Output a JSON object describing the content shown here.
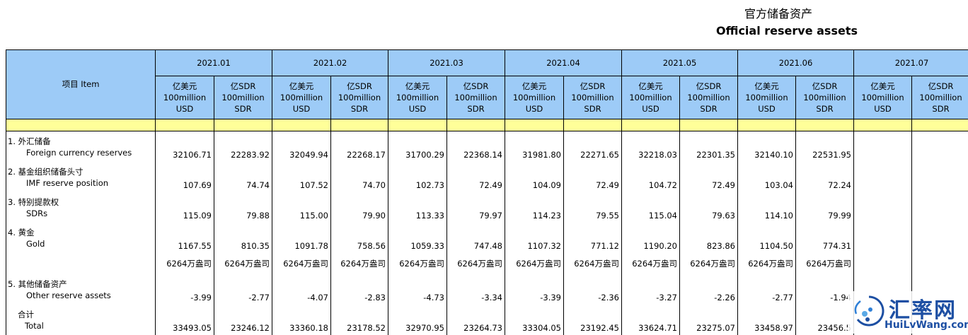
{
  "title_cn": "官方储备资产",
  "title_en": "Official reserve assets",
  "item_header": "项目  Item",
  "months": [
    "2021.01",
    "2021.02",
    "2021.03",
    "2021.04",
    "2021.05",
    "2021.06",
    "2021.07"
  ],
  "units": {
    "usd": [
      "亿美元",
      "100million",
      "USD"
    ],
    "sdr": [
      "亿SDR",
      "100million",
      "SDR"
    ]
  },
  "rows": [
    {
      "cn": "1.  外汇储备",
      "en": "Foreign currency reserves",
      "values": [
        "32106.71",
        "22283.92",
        "32049.94",
        "22268.17",
        "31700.29",
        "22368.14",
        "31981.80",
        "22271.65",
        "32218.03",
        "22301.35",
        "32140.10",
        "22531.95",
        "",
        ""
      ]
    },
    {
      "cn": "2.  基金组织储备头寸",
      "en": "IMF reserve position",
      "values": [
        "107.69",
        "74.74",
        "107.52",
        "74.70",
        "102.73",
        "72.49",
        "104.09",
        "72.49",
        "104.72",
        "72.49",
        "103.04",
        "72.24",
        "",
        ""
      ]
    },
    {
      "cn": "3.  特别提款权",
      "en": "SDRs",
      "values": [
        "115.09",
        "79.88",
        "115.00",
        "79.90",
        "113.33",
        "79.97",
        "114.23",
        "79.55",
        "115.04",
        "79.63",
        "114.10",
        "79.99",
        "",
        ""
      ]
    },
    {
      "cn": "4.  黄金",
      "en": "Gold",
      "values": [
        "1167.55",
        "810.35",
        "1091.78",
        "758.56",
        "1059.33",
        "747.48",
        "1107.32",
        "771.12",
        "1190.20",
        "823.86",
        "1104.50",
        "774.31",
        "",
        ""
      ]
    }
  ],
  "gold_ounces": [
    "6264万盎司",
    "6264万盎司",
    "6264万盎司",
    "6264万盎司",
    "6264万盎司",
    "6264万盎司",
    "6264万盎司",
    "6264万盎司",
    "6264万盎司",
    "6264万盎司",
    "6264万盎司",
    "6264万盎司",
    "",
    ""
  ],
  "other_row": {
    "cn": "5.  其他储备资产",
    "en": "Other reserve assets",
    "values": [
      "-3.99",
      "-2.77",
      "-4.07",
      "-2.83",
      "-4.73",
      "-3.34",
      "-3.39",
      "-2.36",
      "-3.27",
      "-2.26",
      "-2.77",
      "-1.94",
      "",
      ""
    ]
  },
  "total_row": {
    "cn": "合计",
    "en": "Total",
    "values": [
      "33493.05",
      "23246.12",
      "33360.18",
      "23178.52",
      "32970.95",
      "23264.73",
      "33304.05",
      "23192.45",
      "33624.71",
      "23275.07",
      "33458.97",
      "23456.5",
      "",
      ""
    ]
  },
  "watermark": {
    "brand_cn": "汇率网",
    "brand_en": "HuiLvWang.com"
  }
}
